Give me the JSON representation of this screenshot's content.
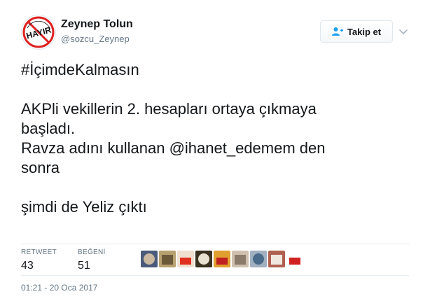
{
  "author": {
    "name": "Zeynep Tolun",
    "handle": "@sozcu_Zeynep",
    "avatar_icon": "hayir-sign-icon",
    "avatar_text": "HAYIR"
  },
  "follow_button": {
    "label": "Takip et",
    "icon": "add-user-icon",
    "accent": "#1da1f2"
  },
  "menu_icon": "chevron-down-icon",
  "tweet": {
    "line1": "#İçimdeKalmasın",
    "line2": "AKPli vekillerin 2. hesapları ortaya çıkmaya",
    "line3": "başladı.",
    "line4_before": "Ravza adını kullanan ",
    "line4_mention": "@ihanet_edemem",
    "line4_after": " den",
    "line5": "sonra",
    "line6": "şimdi de Yeliz çıktı"
  },
  "stats": {
    "retweet_label": "RETWEET",
    "retweet_count": "43",
    "like_label": "BEĞENİ",
    "like_count": "51"
  },
  "liker_avatars": [
    {
      "name": "liker-avatar-1",
      "colors": [
        "#c9b9a0",
        "#4a5a7a"
      ]
    },
    {
      "name": "liker-avatar-2",
      "colors": [
        "#6b5a3a",
        "#b8a070"
      ]
    },
    {
      "name": "liker-avatar-3",
      "colors": [
        "#e03020",
        "#f0e0d0"
      ]
    },
    {
      "name": "liker-avatar-4",
      "colors": [
        "#e8e0d0",
        "#3a3020"
      ]
    },
    {
      "name": "liker-avatar-5",
      "colors": [
        "#c02020",
        "#e0a030"
      ]
    },
    {
      "name": "liker-avatar-6",
      "colors": [
        "#8a7a6a",
        "#d0c0b0"
      ]
    },
    {
      "name": "liker-avatar-7",
      "colors": [
        "#4a6a8a",
        "#a0b0c0"
      ]
    },
    {
      "name": "liker-avatar-8",
      "colors": [
        "#f0e8e0",
        "#b06050"
      ]
    },
    {
      "name": "liker-avatar-9",
      "colors": [
        "#d02020",
        "#ffffff"
      ]
    }
  ],
  "timestamp": "01:21 - 20 Oca 2017",
  "colors": {
    "text": "#14171a",
    "secondary": "#657786",
    "border": "#e1e8ed"
  }
}
